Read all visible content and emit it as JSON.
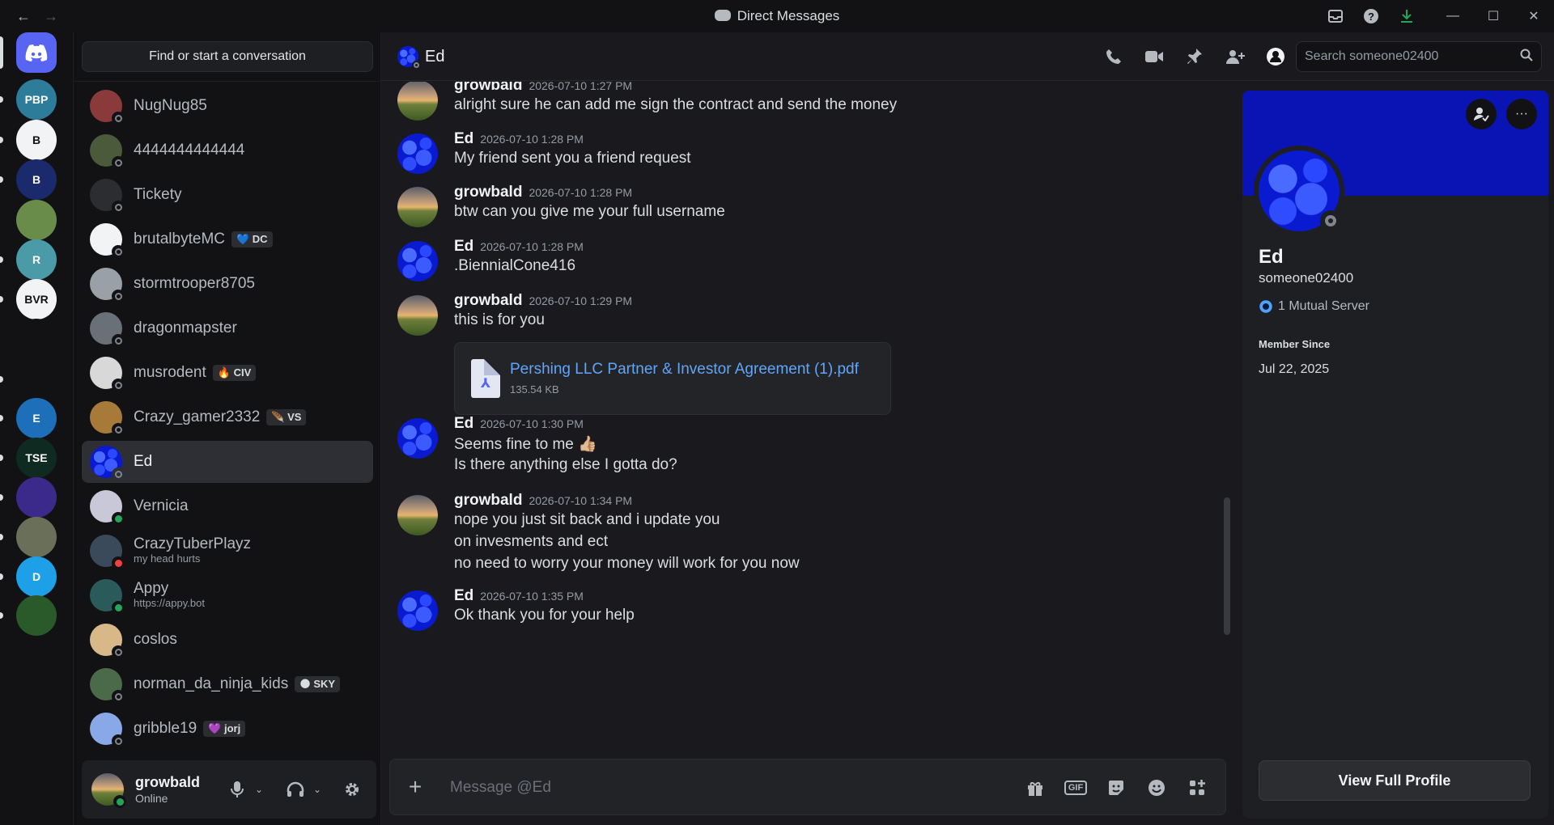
{
  "titlebar": {
    "back": "←",
    "forward": "→",
    "title": "Direct Messages",
    "icons": {
      "inbox": "inbox-icon",
      "help": "help-icon",
      "download": "download-icon"
    },
    "window": {
      "minimize": "—",
      "maximize": "☐",
      "close": "✕"
    }
  },
  "servers": [
    {
      "label": "",
      "color": "#5865f2"
    },
    {
      "label": "PBP",
      "color": "#2d7d9a"
    },
    {
      "label": "B",
      "color": "#f2f3f5"
    },
    {
      "label": "B",
      "color": "#1a2a6c"
    },
    {
      "label": "",
      "color": "#6a8c4a"
    },
    {
      "label": "R",
      "color": "#4a9aa8"
    },
    {
      "label": "BVR",
      "color": "#f2f3f5"
    },
    {
      "label": "",
      "color": "#121214"
    },
    {
      "label": "",
      "color": "#121214"
    },
    {
      "label": "E",
      "color": "#1c6fb8"
    },
    {
      "label": "TSE",
      "color": "#0f2a20"
    },
    {
      "label": "",
      "color": "#3b2a8a"
    },
    {
      "label": "",
      "color": "#6a6f5a"
    },
    {
      "label": "D",
      "color": "#1ea0e8"
    },
    {
      "label": "",
      "color": "#2a5a2a"
    }
  ],
  "dm_list": {
    "find_placeholder": "Find or start a conversation",
    "items": [
      {
        "name": "NugNug85",
        "status": "offline",
        "av": "#8a3a3a"
      },
      {
        "name": "4444444444444",
        "status": "offline",
        "av": "#4a5a3a"
      },
      {
        "name": "Tickety",
        "status": "offline",
        "av": "#2b2d31"
      },
      {
        "name": "brutalbyteMC",
        "status": "offline",
        "av": "#f2f3f5",
        "tag": "DC",
        "tag_icon": "💙"
      },
      {
        "name": "stormtrooper8705",
        "status": "offline",
        "av": "#9aa0a8"
      },
      {
        "name": "dragonmapster",
        "status": "offline",
        "av": "#6a7078"
      },
      {
        "name": "musrodent",
        "status": "offline",
        "av": "#d8d8d8",
        "tag": "CIV",
        "tag_icon": "🔥"
      },
      {
        "name": "Crazy_gamer2332",
        "status": "offline",
        "av": "#a87a3a",
        "tag": "VS",
        "tag_icon": "🪶"
      },
      {
        "name": "Ed",
        "status": "offline",
        "av": "jelly",
        "active": true
      },
      {
        "name": "Vernicia",
        "status": "online",
        "av": "#c8c8d8"
      },
      {
        "name": "CrazyTuberPlayz",
        "sub": "my head hurts",
        "status": "dnd",
        "av": "#3a4a5a"
      },
      {
        "name": "Appy",
        "sub": "https://appy.bot",
        "status": "online",
        "av": "#2a5a5a"
      },
      {
        "name": "coslos",
        "status": "offline",
        "av": "#d8b888"
      },
      {
        "name": "norman_da_ninja_kids",
        "status": "offline",
        "av": "#4a6a4a",
        "tag": "SKY",
        "tag_icon": "🌑"
      },
      {
        "name": "gribble19",
        "status": "offline",
        "av": "#88a8e8",
        "tag": "jorj",
        "tag_icon": "💜"
      }
    ]
  },
  "user_panel": {
    "name": "growbald",
    "status": "Online",
    "icons": {
      "mic": "microphone-icon",
      "headset": "headset-icon",
      "settings": "gear-icon"
    }
  },
  "chat_header": {
    "name": "Ed",
    "search_placeholder": "Search someone02400",
    "icons": [
      "phone-icon",
      "video-icon",
      "pin-icon",
      "add-friend-icon",
      "profile-icon"
    ]
  },
  "messages": [
    {
      "author": "growbald",
      "time": "2026-07-10 1:27 PM",
      "lines": [
        "alright sure he can add me sign the contract and send the money"
      ],
      "av": "sunset"
    },
    {
      "author": "Ed",
      "time": "2026-07-10 1:28 PM",
      "lines": [
        "My friend sent you a friend request"
      ],
      "av": "jelly"
    },
    {
      "author": "growbald",
      "time": "2026-07-10 1:28 PM",
      "lines": [
        "btw can you give me your full username"
      ],
      "av": "sunset"
    },
    {
      "author": "Ed",
      "time": "2026-07-10 1:28 PM",
      "lines": [
        ".BiennialCone416"
      ],
      "av": "jelly"
    },
    {
      "author": "growbald",
      "time": "2026-07-10 1:29 PM",
      "lines": [
        "this is for you"
      ],
      "av": "sunset",
      "attachment": {
        "name": "Pershing LLC Partner & Investor Agreement (1).pdf",
        "size": "135.54 KB"
      }
    },
    {
      "author": "Ed",
      "time": "2026-07-10 1:30 PM",
      "lines": [
        "Seems fine to me 👍🏼",
        "Is there anything else I gotta do?"
      ],
      "av": "jelly"
    },
    {
      "author": "growbald",
      "time": "2026-07-10 1:34 PM",
      "lines": [
        "nope you just sit back and i update you",
        "on invesments and ect",
        "no need to worry your money will work for you now"
      ],
      "av": "sunset"
    },
    {
      "author": "Ed",
      "time": "2026-07-10 1:35 PM",
      "lines": [
        "Ok thank you for your help"
      ],
      "av": "jelly"
    }
  ],
  "composer": {
    "placeholder": "Message @Ed",
    "icons": [
      "gift-icon",
      "gif-icon",
      "sticker-icon",
      "emoji-icon",
      "apps-icon"
    ],
    "gif_label": "GIF"
  },
  "profile": {
    "name": "Ed",
    "username": "someone02400",
    "mutual": "1 Mutual Server",
    "member_since_label": "Member Since",
    "member_since": "Jul 22, 2025",
    "view_full": "View Full Profile",
    "banner_color": "#0a14b4"
  }
}
